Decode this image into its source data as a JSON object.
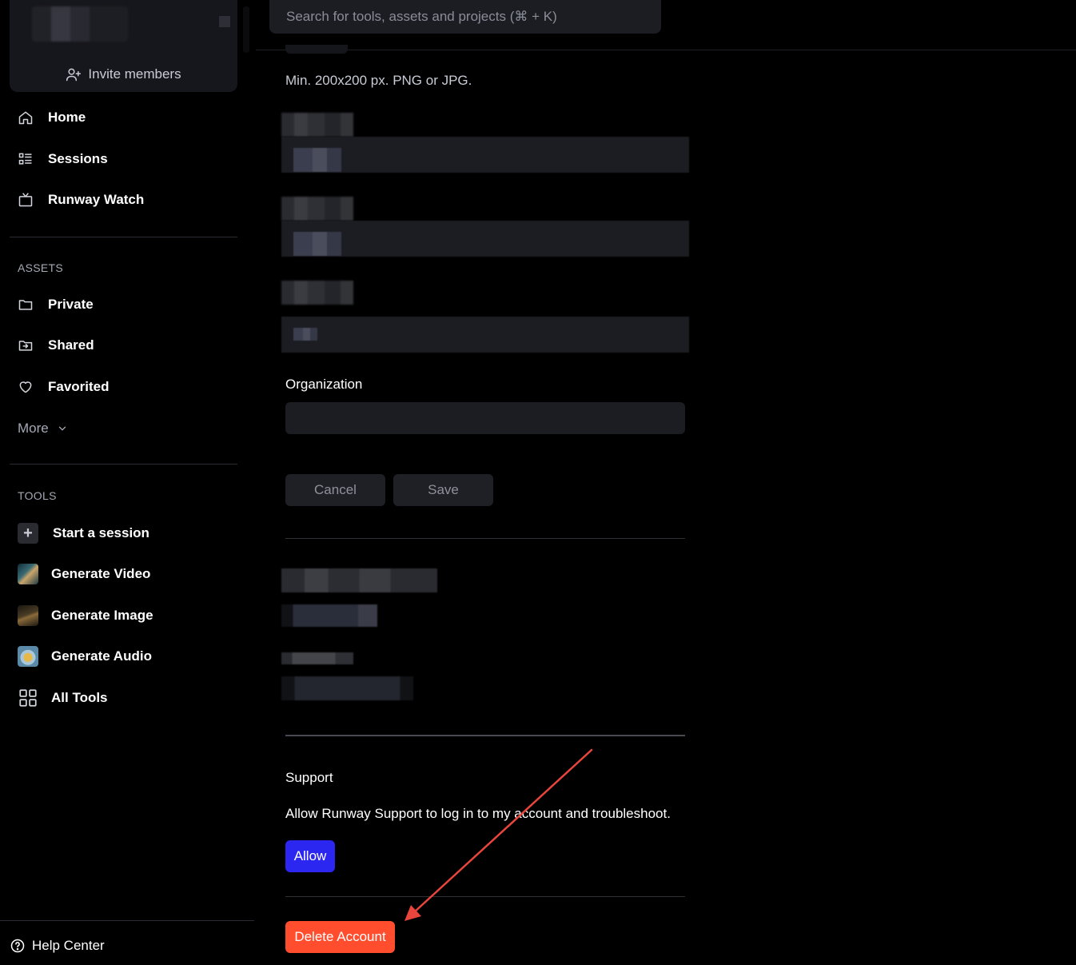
{
  "sidebar": {
    "invite_label": "Invite members",
    "nav": [
      {
        "label": "Home",
        "icon": "home-icon"
      },
      {
        "label": "Sessions",
        "icon": "list-icon"
      },
      {
        "label": "Runway Watch",
        "icon": "tv-icon"
      }
    ],
    "assets_label": "ASSETS",
    "assets": [
      {
        "label": "Private",
        "icon": "folder-icon"
      },
      {
        "label": "Shared",
        "icon": "shared-folder-icon"
      },
      {
        "label": "Favorited",
        "icon": "heart-icon"
      }
    ],
    "more_label": "More",
    "tools_label": "TOOLS",
    "tools": [
      {
        "label": "Start a session",
        "icon": "plus-icon"
      },
      {
        "label": "Generate Video",
        "icon": "video-thumbnail"
      },
      {
        "label": "Generate Image",
        "icon": "image-thumbnail"
      },
      {
        "label": "Generate Audio",
        "icon": "audio-thumbnail"
      },
      {
        "label": "All Tools",
        "icon": "grid-icon"
      }
    ],
    "help_label": "Help Center"
  },
  "search": {
    "placeholder": "Search for tools, assets and projects (⌘ + K)"
  },
  "profile": {
    "image_hint": "Min. 200x200 px. PNG or JPG.",
    "organization_label": "Organization",
    "organization_value": "",
    "cancel_label": "Cancel",
    "save_label": "Save"
  },
  "support": {
    "title": "Support",
    "description": "Allow Runway Support to log in to my account and troubleshoot.",
    "allow_label": "Allow"
  },
  "danger": {
    "delete_label": "Delete Account"
  },
  "colors": {
    "allow": "#2b27f0",
    "delete": "#ff4d2e",
    "annotation_arrow": "#e8453c"
  }
}
